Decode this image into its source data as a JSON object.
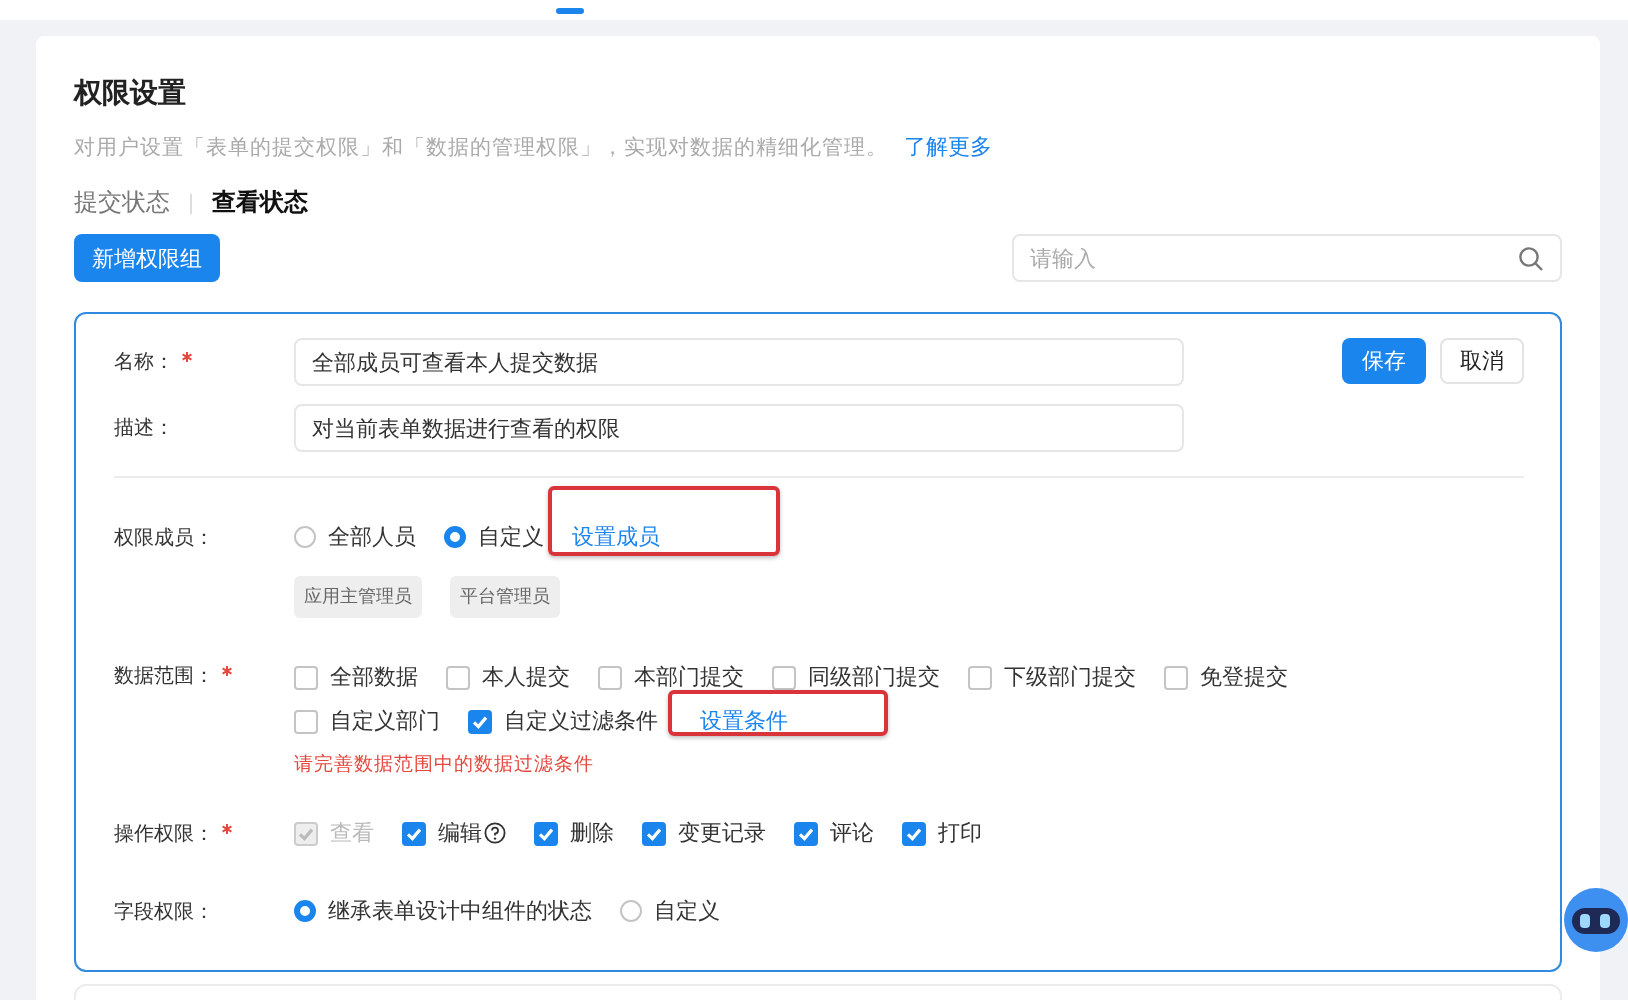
{
  "page": {
    "title": "权限设置",
    "description": "对用户设置「表单的提交权限」和「数据的管理权限」，实现对数据的精细化管理。",
    "link": "了解更多"
  },
  "tabs": [
    {
      "label": "提交状态",
      "selected": false
    },
    {
      "label": "查看状态",
      "selected": true
    }
  ],
  "add_button": "新增权限组",
  "search": {
    "placeholder": "请输入"
  },
  "group": {
    "name": {
      "label": "名称：",
      "required": true,
      "value": "全部成员可查看本人提交数据"
    },
    "description": {
      "label": "描述：",
      "value": "对当前表单数据进行查看的权限"
    },
    "save_button": "保存",
    "cancel_button": "取消",
    "members": {
      "label": "权限成员：",
      "options": [
        {
          "label": "全部人员",
          "selected": false
        },
        {
          "label": "自定义",
          "selected": true
        }
      ],
      "link": "设置成员",
      "highlighted": true,
      "tags": [
        "应用主管理员",
        "平台管理员"
      ]
    },
    "data_scope": {
      "label": "数据范围：",
      "required": true,
      "option_rows": [
        [
          {
            "label": "全部数据",
            "checked": false
          },
          {
            "label": "本人提交",
            "checked": false
          },
          {
            "label": "本部门提交",
            "checked": false
          },
          {
            "label": "同级部门提交",
            "checked": false
          },
          {
            "label": "下级部门提交",
            "checked": false
          },
          {
            "label": "免登提交",
            "checked": false
          }
        ],
        [
          {
            "label": "自定义部门",
            "checked": false
          },
          {
            "label": "自定义过滤条件",
            "checked": true
          }
        ]
      ],
      "link": "设置条件",
      "highlighted": true,
      "error": "请完善数据范围中的数据过滤条件"
    },
    "operations": {
      "label": "操作权限：",
      "required": true,
      "options": [
        {
          "label": "查看",
          "checked": true,
          "disabled": true
        },
        {
          "label": "编辑",
          "checked": true,
          "disabled": false,
          "help": true
        },
        {
          "label": "删除",
          "checked": true,
          "disabled": false
        },
        {
          "label": "变更记录",
          "checked": true,
          "disabled": false
        },
        {
          "label": "评论",
          "checked": true,
          "disabled": false
        },
        {
          "label": "打印",
          "checked": true,
          "disabled": false
        }
      ]
    },
    "field_permissions": {
      "label": "字段权限：",
      "options": [
        {
          "label": "继承表单设计中组件的状态",
          "selected": true
        },
        {
          "label": "自定义",
          "selected": false
        }
      ]
    }
  }
}
